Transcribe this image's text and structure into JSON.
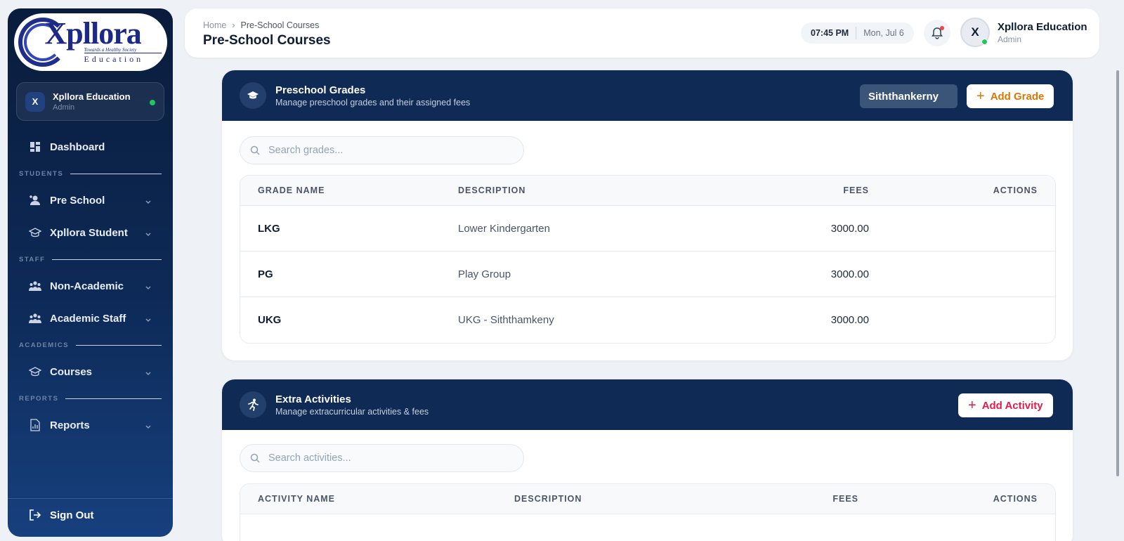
{
  "sidebar": {
    "logo": {
      "text": "Xpllora",
      "tagline": "Towards a Healthy Society",
      "sub": "Education"
    },
    "user": {
      "initial": "X",
      "name": "Xpllora Education",
      "role": "Admin"
    },
    "dashboard": "Dashboard",
    "sections": {
      "students": "STUDENTS",
      "staff": "STAFF",
      "academics": "ACADEMICS",
      "reports": "REPORTS"
    },
    "items": {
      "pre_school": "Pre School",
      "xpllora_student": "Xpllora Student",
      "non_academic": "Non-Academic",
      "academic_staff": "Academic Staff",
      "courses": "Courses",
      "reports": "Reports"
    },
    "sign_out": "Sign Out"
  },
  "header": {
    "breadcrumb": [
      "Home",
      "Pre-School Courses"
    ],
    "title": "Pre-School Courses",
    "time": "07:45 PM",
    "date": "Mon, Jul 6",
    "user": {
      "initial": "X",
      "name": "Xpllora Education",
      "role": "Admin"
    }
  },
  "grades": {
    "title": "Preschool Grades",
    "subtitle": "Manage preschool grades and their assigned fees",
    "branch": "Siththankerny",
    "add_label": "Add Grade",
    "search_placeholder": "Search grades...",
    "columns": [
      "GRADE NAME",
      "DESCRIPTION",
      "FEES",
      "ACTIONS"
    ],
    "rows": [
      {
        "name": "LKG",
        "description": "Lower Kindergarten",
        "fees": "3000.00"
      },
      {
        "name": "PG",
        "description": "Play Group",
        "fees": "3000.00"
      },
      {
        "name": "UKG",
        "description": "UKG - Siththamkeny",
        "fees": "3000.00"
      }
    ]
  },
  "activities": {
    "title": "Extra Activities",
    "subtitle": "Manage extracurricular activities & fees",
    "add_label": "Add Activity",
    "search_placeholder": "Search activities...",
    "columns": [
      "ACTIVITY NAME",
      "DESCRIPTION",
      "FEES",
      "ACTIONS"
    ]
  },
  "colors": {
    "sidebar_top": "#0a1c3c",
    "card_header": "#0e2a55",
    "add_grade": "#d97706",
    "add_activity": "#e11d48",
    "online": "#22c55e"
  }
}
